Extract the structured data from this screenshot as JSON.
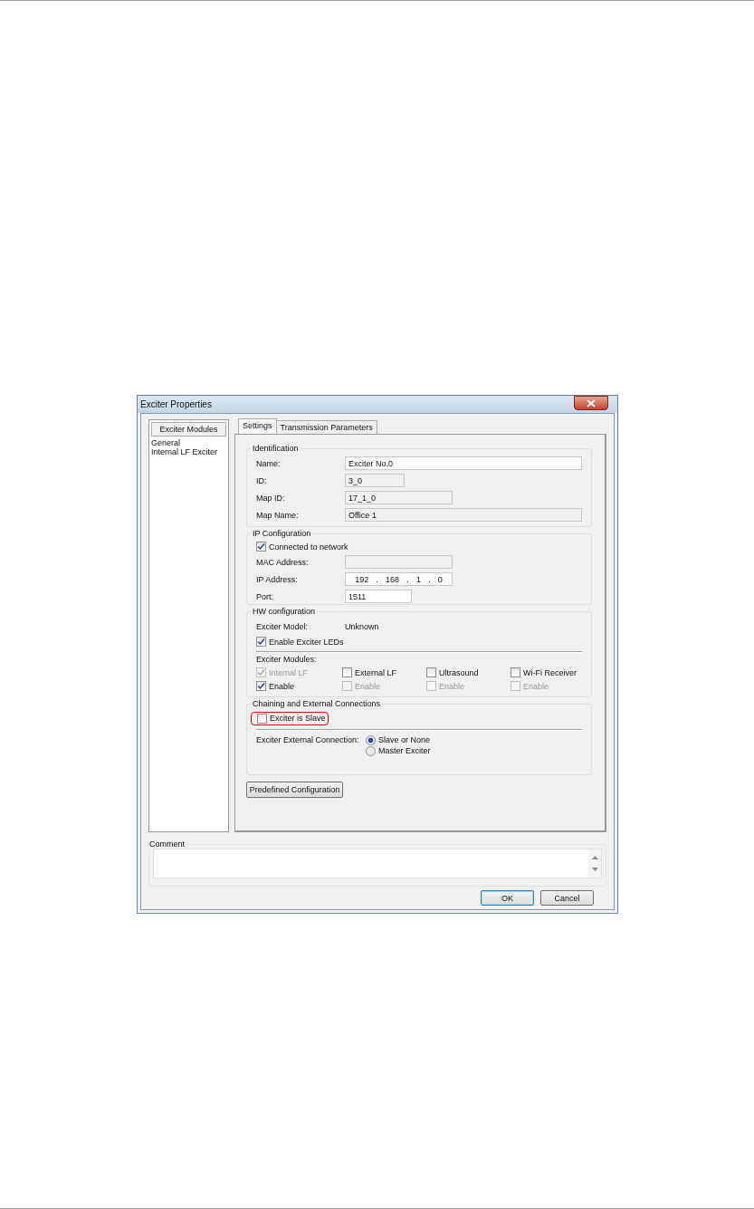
{
  "window": {
    "title": "Exciter Properties"
  },
  "sidebar": {
    "header": "Exciter Modules",
    "items": [
      {
        "label": "General",
        "selected": false
      },
      {
        "label": "Internal LF Exciter",
        "selected": false
      }
    ]
  },
  "tabs": [
    {
      "label": "Settings",
      "selected": true
    },
    {
      "label": "Transmission Parameters",
      "selected": false
    }
  ],
  "identification": {
    "title": "Identification",
    "fields": [
      {
        "label": "Name:",
        "value": "Exciter No.0",
        "disabled": false,
        "kind": "wide"
      },
      {
        "label": "ID:",
        "value": "3_0",
        "disabled": true,
        "kind": "short"
      },
      {
        "label": "Map ID:",
        "value": "17_1_0",
        "disabled": true,
        "kind": "medium"
      },
      {
        "label": "Map Name:",
        "value": "Office 1",
        "disabled": true,
        "kind": "wide"
      }
    ]
  },
  "ip_configuration": {
    "title": "IP Configuration",
    "connected": {
      "label": "Connected to network",
      "checked": true
    },
    "fields": [
      {
        "label": "MAC Address:",
        "kind": "medium",
        "disabled": true
      },
      {
        "label": "IP Address:",
        "kind": "ip",
        "octets": [
          "192",
          "168",
          "1",
          "0"
        ]
      },
      {
        "label": "Port:",
        "kind": "port",
        "value": "1511",
        "disabled": false
      }
    ]
  },
  "hw_configuration": {
    "title": "HW configuration",
    "model_label": "Exciter Model:",
    "model_value": "Unknown",
    "leds": {
      "label": "Enable Exciter LEDs",
      "checked": true
    },
    "modules_label": "Exciter Modules:",
    "modules": [
      {
        "label": "Internal LF",
        "checked": true,
        "disabled": true,
        "enable": {
          "label": "Enable",
          "checked": true,
          "disabled": false
        }
      },
      {
        "label": "External LF",
        "checked": false,
        "disabled": false,
        "enable": {
          "label": "Enable",
          "checked": false,
          "disabled": true
        }
      },
      {
        "label": "Ultrasound",
        "checked": false,
        "disabled": false,
        "enable": {
          "label": "Enable",
          "checked": false,
          "disabled": true
        }
      },
      {
        "label": "Wi-Fi Receiver",
        "checked": false,
        "disabled": false,
        "enable": {
          "label": "Enable",
          "checked": false,
          "disabled": true
        }
      }
    ]
  },
  "chaining": {
    "title": "Chaining and External Connections",
    "slave": {
      "label": "Exciter is Slave",
      "checked": false,
      "highlighted": true
    },
    "connection_label": "Exciter External Connection:",
    "options": [
      {
        "label": "Slave or None",
        "selected": true
      },
      {
        "label": "Master Exciter",
        "selected": false
      }
    ]
  },
  "predefined_button": "Predefined Configuration",
  "comment": {
    "label": "Comment"
  },
  "buttons": [
    {
      "label": "OK",
      "default": true
    },
    {
      "label": "Cancel",
      "default": false
    }
  ]
}
